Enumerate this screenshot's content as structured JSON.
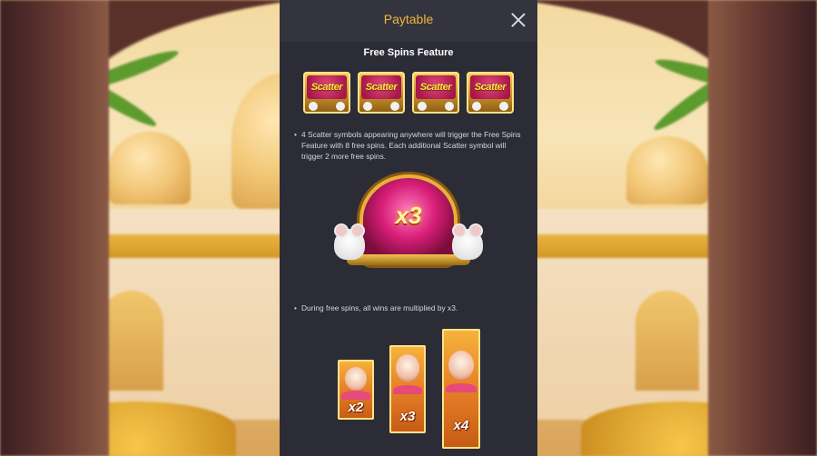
{
  "panel": {
    "title": "Paytable",
    "section_title": "Free Spins Feature",
    "scatter_label": "Scatter",
    "scatter_count": 4,
    "bullet_1": "4 Scatter symbols appearing anywhere will trigger the Free Spins Feature with 8 free spins. Each additional Scatter symbol will trigger 2 more free spins.",
    "multiplier_label": "x3",
    "bullet_2": "During free spins, all wins are multiplied by x3.",
    "wilds": [
      {
        "label": "x2"
      },
      {
        "label": "x3"
      },
      {
        "label": "x4"
      }
    ]
  },
  "colors": {
    "accent_title": "#f2b63c",
    "panel_bg": "#2c2c36",
    "header_bg": "#34343f"
  },
  "icons": {
    "close": "close-icon",
    "scatter": "scatter-symbol-icon",
    "multiplier": "multiplier-x3-icon",
    "wild": "ganesha-wild-icon"
  }
}
